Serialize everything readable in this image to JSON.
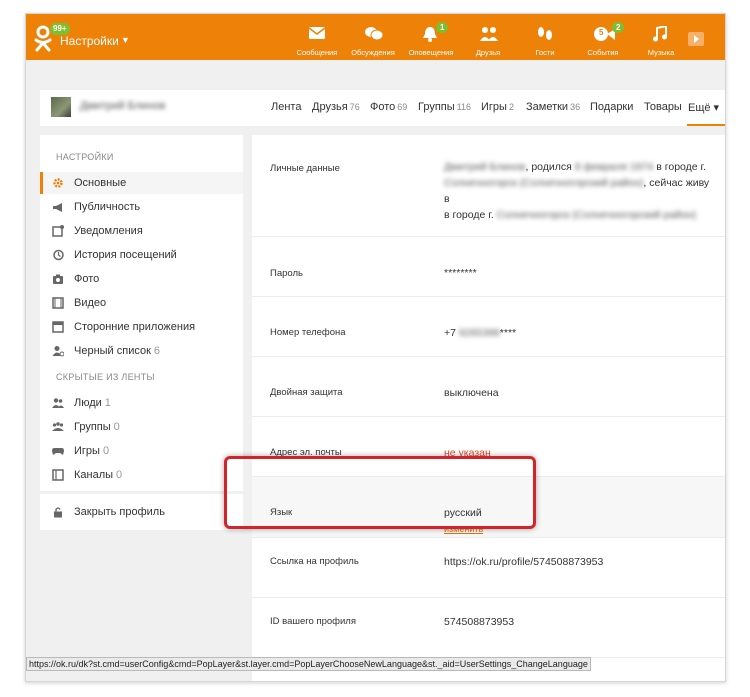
{
  "header": {
    "logo_badge": "99+",
    "title": "Настройки",
    "caret": "▼",
    "nav": [
      {
        "label": "Сообщения",
        "icon": "envelope-icon",
        "badge": ""
      },
      {
        "label": "Обсуждения",
        "icon": "chat-icon",
        "badge": ""
      },
      {
        "label": "Оповещения",
        "icon": "bell-icon",
        "badge": "1"
      },
      {
        "label": "Друзья",
        "icon": "friends-icon",
        "badge": ""
      },
      {
        "label": "Гости",
        "icon": "footprints-icon",
        "badge": ""
      },
      {
        "label": "События",
        "icon": "events-icon",
        "badge": "2"
      },
      {
        "label": "Музыка",
        "icon": "music-note-icon",
        "badge": ""
      }
    ],
    "events_inner_badge": "5"
  },
  "profile_nav": {
    "name": "Дмитрий Блинов",
    "tabs": [
      {
        "label": "Лента",
        "count": ""
      },
      {
        "label": "Друзья",
        "count": "76"
      },
      {
        "label": "Фото",
        "count": "69"
      },
      {
        "label": "Группы",
        "count": "116"
      },
      {
        "label": "Игры",
        "count": "2"
      },
      {
        "label": "Заметки",
        "count": "36"
      },
      {
        "label": "Подарки",
        "count": ""
      },
      {
        "label": "Товары",
        "count": ""
      },
      {
        "label": "Ещё ▾",
        "count": ""
      }
    ]
  },
  "sidebar": {
    "settings_heading": "НАСТРОЙКИ",
    "items": [
      {
        "label": "Основные",
        "count": "",
        "icon": "gear-icon"
      },
      {
        "label": "Публичность",
        "count": "",
        "icon": "megaphone-icon"
      },
      {
        "label": "Уведомления",
        "count": "",
        "icon": "notification-icon"
      },
      {
        "label": "История посещений",
        "count": "",
        "icon": "history-icon"
      },
      {
        "label": "Фото",
        "count": "",
        "icon": "camera-icon"
      },
      {
        "label": "Видео",
        "count": "",
        "icon": "video-icon"
      },
      {
        "label": "Сторонние приложения",
        "count": "",
        "icon": "apps-icon"
      },
      {
        "label": "Черный список",
        "count": "6",
        "icon": "blacklist-icon"
      }
    ],
    "hidden_heading": "СКРЫТЫЕ ИЗ ЛЕНТЫ",
    "hidden_items": [
      {
        "label": "Люди",
        "count": "1",
        "icon": "people-icon"
      },
      {
        "label": "Группы",
        "count": "0",
        "icon": "groups-icon"
      },
      {
        "label": "Игры",
        "count": "0",
        "icon": "gamepad-icon"
      },
      {
        "label": "Каналы",
        "count": "0",
        "icon": "channels-icon"
      }
    ],
    "close_profile": {
      "label": "Закрыть профиль",
      "icon": "lock-icon"
    }
  },
  "settings": {
    "personal": {
      "label": "Личные данные",
      "name": "Дмитрий Блинов",
      "t1": ", родился ",
      "dob": "8 февраля 1974",
      "t2": " в городе г.",
      "city1": "Солнечногорск (Солнечногорский район)",
      "t3": ", сейчас живу в",
      "t4": "в городе г. ",
      "city2": "Солнечногорск (Солнечногорский район)"
    },
    "password": {
      "label": "Пароль",
      "value": "********"
    },
    "phone": {
      "label": "Номер телефона",
      "prefix": "+7 ",
      "hidden": "9265399",
      "suffix": "****"
    },
    "twofa": {
      "label": "Двойная защита",
      "value": "выключена"
    },
    "email": {
      "label": "Адрес эл. почты",
      "value": "не указан"
    },
    "language": {
      "label": "Язык",
      "value": "русский",
      "change": "изменить"
    },
    "profile_link": {
      "label": "Ссылка на профиль",
      "value": "https://ok.ru/profile/574508873953"
    },
    "profile_id": {
      "label": "ID вашего профиля",
      "value": "574508873953"
    }
  },
  "status_bar": "https://ok.ru/dk?st.cmd=userConfig&cmd=PopLayer&st.layer.cmd=PopLayerChooseNewLanguage&st._aid=UserSettings_ChangeLanguage",
  "colors": {
    "accent": "#ee8208",
    "badge": "#7dbf2e",
    "highlight": "#d2252b",
    "warning": "#e5442d"
  }
}
